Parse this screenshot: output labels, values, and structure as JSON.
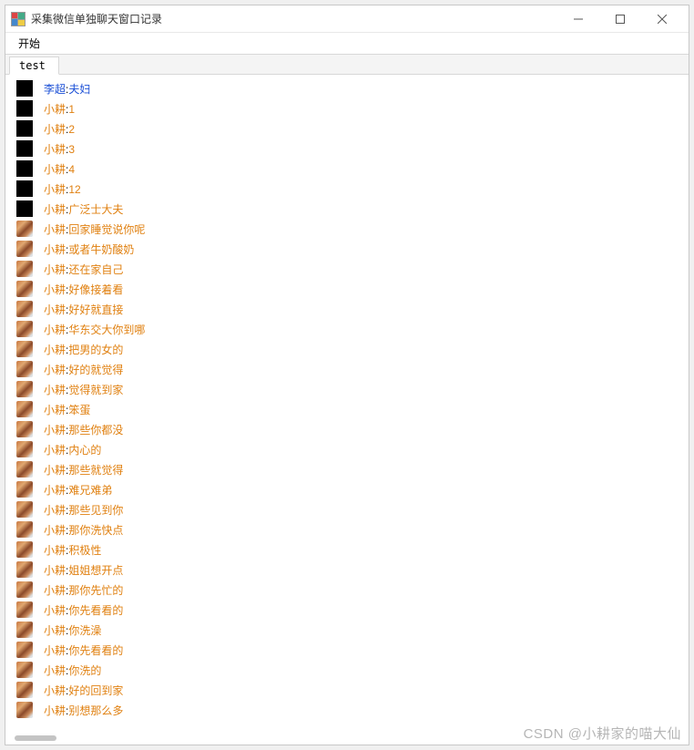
{
  "window": {
    "title": "采集微信单独聊天窗口记录"
  },
  "menubar": {
    "start": "开始"
  },
  "tabs": {
    "active": "test"
  },
  "messages": [
    {
      "avatar": "black",
      "name": "李超",
      "text": "夫妇",
      "highlight": true
    },
    {
      "avatar": "black",
      "name": "小耕",
      "text": "1"
    },
    {
      "avatar": "black",
      "name": "小耕",
      "text": "2"
    },
    {
      "avatar": "black",
      "name": "小耕",
      "text": "3"
    },
    {
      "avatar": "black",
      "name": "小耕",
      "text": "4"
    },
    {
      "avatar": "black",
      "name": "小耕",
      "text": "12"
    },
    {
      "avatar": "black",
      "name": "小耕",
      "text": "广泛士大夫"
    },
    {
      "avatar": "pic",
      "name": "小耕",
      "text": "回家睡觉说你呢"
    },
    {
      "avatar": "pic",
      "name": "小耕",
      "text": "或者牛奶酸奶"
    },
    {
      "avatar": "pic",
      "name": "小耕",
      "text": "还在家自己"
    },
    {
      "avatar": "pic",
      "name": "小耕",
      "text": "好像接着看"
    },
    {
      "avatar": "pic",
      "name": "小耕",
      "text": "好好就直接"
    },
    {
      "avatar": "pic",
      "name": "小耕",
      "text": "华东交大你到哪"
    },
    {
      "avatar": "pic",
      "name": "小耕",
      "text": "把男的女的"
    },
    {
      "avatar": "pic",
      "name": "小耕",
      "text": "好的就觉得"
    },
    {
      "avatar": "pic",
      "name": "小耕",
      "text": "觉得就到家"
    },
    {
      "avatar": "pic",
      "name": "小耕",
      "text": "笨蛋"
    },
    {
      "avatar": "pic",
      "name": "小耕",
      "text": "那些你都没"
    },
    {
      "avatar": "pic",
      "name": "小耕",
      "text": "内心的"
    },
    {
      "avatar": "pic",
      "name": "小耕",
      "text": "那些就觉得"
    },
    {
      "avatar": "pic",
      "name": "小耕",
      "text": "难兄难弟"
    },
    {
      "avatar": "pic",
      "name": "小耕",
      "text": "那些见到你"
    },
    {
      "avatar": "pic",
      "name": "小耕",
      "text": "那你洗快点"
    },
    {
      "avatar": "pic",
      "name": "小耕",
      "text": "积极性"
    },
    {
      "avatar": "pic",
      "name": "小耕",
      "text": "姐姐想开点"
    },
    {
      "avatar": "pic",
      "name": "小耕",
      "text": "那你先忙的"
    },
    {
      "avatar": "pic",
      "name": "小耕",
      "text": "你先看看的"
    },
    {
      "avatar": "pic",
      "name": "小耕",
      "text": "你洗澡"
    },
    {
      "avatar": "pic",
      "name": "小耕",
      "text": "你先看看的"
    },
    {
      "avatar": "pic",
      "name": "小耕",
      "text": "你洗的"
    },
    {
      "avatar": "pic",
      "name": "小耕",
      "text": "好的回到家"
    },
    {
      "avatar": "pic",
      "name": "小耕",
      "text": "别想那么多"
    }
  ],
  "watermark": "CSDN @小耕家的喵大仙"
}
